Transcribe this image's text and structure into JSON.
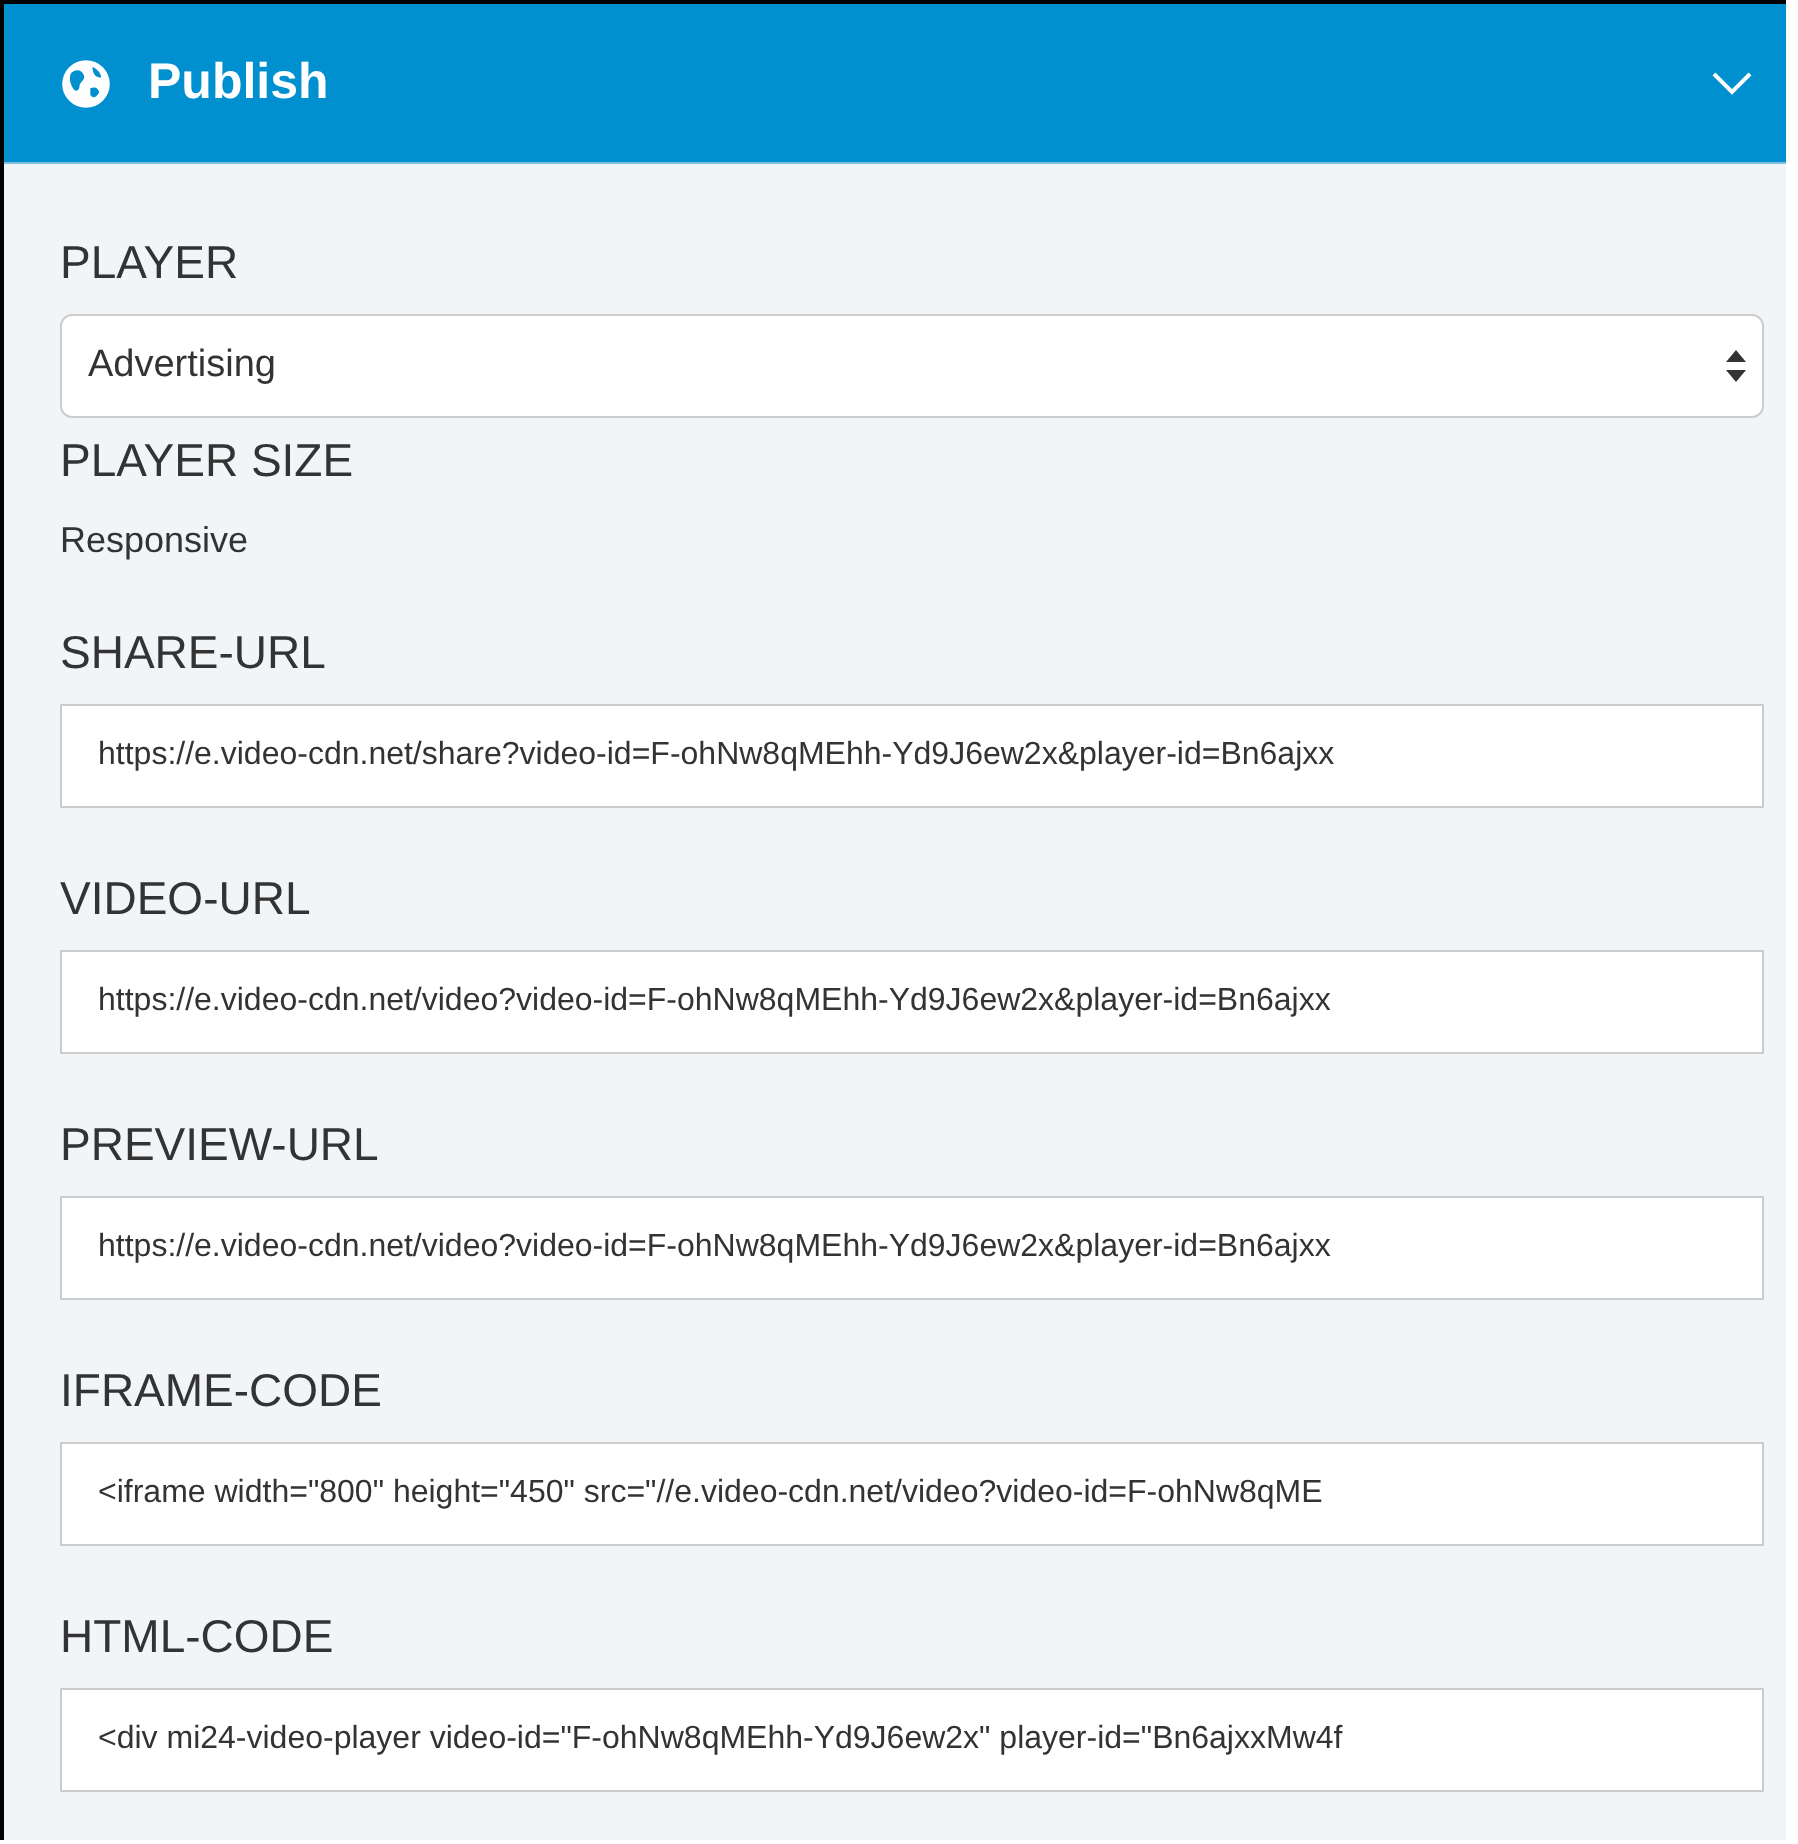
{
  "panel": {
    "title": "Publish",
    "expanded": true
  },
  "player": {
    "label": "PLAYER",
    "value": "Advertising"
  },
  "player_size": {
    "label": "PLAYER SIZE",
    "value": "Responsive"
  },
  "fields": [
    {
      "label": "SHARE-URL",
      "value": "https://e.video-cdn.net/share?video-id=F-ohNw8qMEhh-Yd9J6ew2x&player-id=Bn6ajxx"
    },
    {
      "label": "VIDEO-URL",
      "value": "https://e.video-cdn.net/video?video-id=F-ohNw8qMEhh-Yd9J6ew2x&player-id=Bn6ajxx"
    },
    {
      "label": "PREVIEW-URL",
      "value": "https://e.video-cdn.net/video?video-id=F-ohNw8qMEhh-Yd9J6ew2x&player-id=Bn6ajxx"
    },
    {
      "label": "IFRAME-CODE",
      "value": "<iframe width=\"800\" height=\"450\" src=\"//e.video-cdn.net/video?video-id=F-ohNw8qME"
    },
    {
      "label": "HTML-CODE",
      "value": "<div mi24-video-player video-id=\"F-ohNw8qMEhh-Yd9J6ew2x\" player-id=\"Bn6ajxxMw4f"
    }
  ]
}
